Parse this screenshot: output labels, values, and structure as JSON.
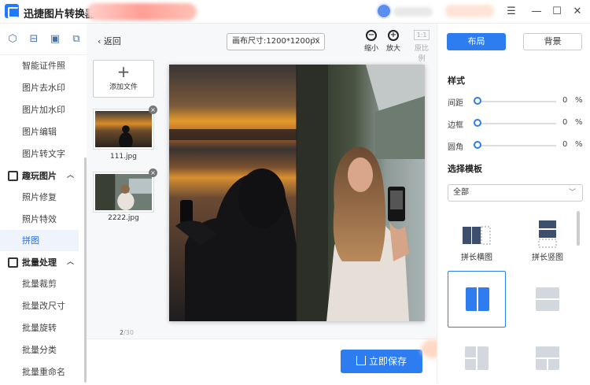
{
  "app": {
    "title": "迅捷图片转换器"
  },
  "window": {
    "menu_glyph": "☰",
    "min_glyph": "—",
    "max_glyph": "☐",
    "close_glyph": "✕"
  },
  "sidebar": {
    "items_top": [
      "智能证件照",
      "图片去水印",
      "图片加水印",
      "图片编辑",
      "图片转文字"
    ],
    "group_fun": {
      "label": "趣玩图片",
      "items": [
        "照片修复",
        "照片特效",
        "拼图"
      ]
    },
    "group_batch": {
      "label": "批量处理",
      "items": [
        "批量裁剪",
        "批量改尺寸",
        "批量旋转",
        "批量分类",
        "批量重命名"
      ]
    },
    "active": "拼图"
  },
  "toolbar": {
    "back_label": "返回",
    "canvas_size": "画布尺寸:1200*1200px",
    "zoom_out_label": "缩小",
    "zoom_in_label": "放大",
    "ratio_box": "1:1",
    "ratio_label": "原比例"
  },
  "files": {
    "add_label": "添加文件",
    "items": [
      {
        "name": "111.jpg"
      },
      {
        "name": "2222.jpg"
      }
    ],
    "count": "2",
    "total": "/30"
  },
  "save_label": "立即保存",
  "right": {
    "tab_layout": "布局",
    "tab_bg": "背景",
    "style_title": "样式",
    "sliders": [
      {
        "label": "间距",
        "value": "0",
        "unit": "%",
        "level": 0
      },
      {
        "label": "边框",
        "value": "0",
        "unit": "%",
        "level": 0
      },
      {
        "label": "圆角",
        "value": "0",
        "unit": "%",
        "level": 0
      }
    ],
    "template_title": "选择模板",
    "template_filter": "全部",
    "templates": [
      {
        "label": "拼长横图",
        "icon": "long-horizontal-icon"
      },
      {
        "label": "拼长竖图",
        "icon": "long-vertical-icon"
      },
      {
        "label": "",
        "icon": "two-column-icon"
      },
      {
        "label": "",
        "icon": "two-row-icon"
      },
      {
        "label": "",
        "icon": "grid-icon"
      },
      {
        "label": "",
        "icon": "grid-icon"
      }
    ]
  },
  "colors": {
    "accent": "#2d7cf0"
  }
}
